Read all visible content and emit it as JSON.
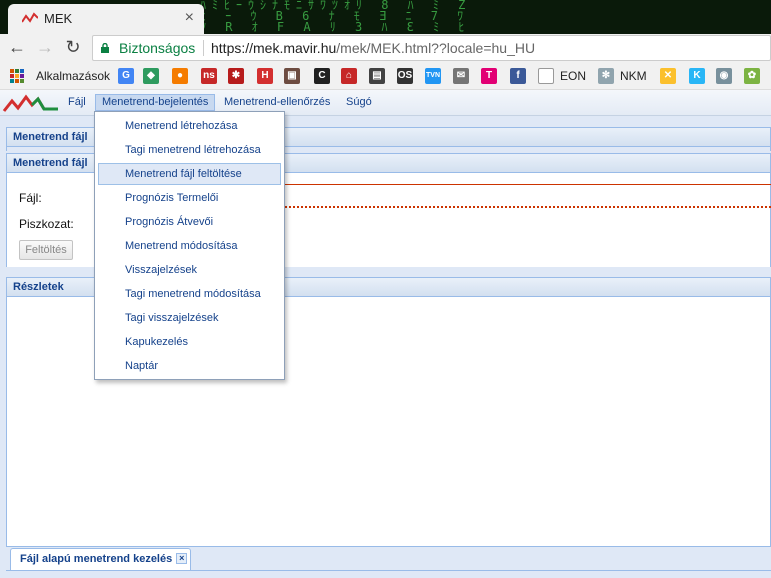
{
  "browser": {
    "tab_title": "MEK",
    "tab_close": "×",
    "secure_label": "Biztonságos",
    "url_host": "https://mek.mavir.hu",
    "url_path": "/mek/MEK.html??locale=hu_HU",
    "back": "←",
    "forward": "→",
    "reload": "↻",
    "matrix_text": "ﾊﾐﾋｰｳｼﾅﾓﾆｻﾜﾂｵﾘ 8 ﾊ ﾐ Z\nﾋ ｰ ｳ B 6 ﾅ ﾓ Ǝ ﾆ 7 ﾜ\nﾂ R ｵ F A ﾘ 3 ﾊ Ɛ ﾐ ﾋ"
  },
  "bookmarks": [
    {
      "label": "Alkalmazások",
      "icon": "apps-icon",
      "color": "#d35400"
    },
    {
      "label": "",
      "icon": "google-icon",
      "glyph": "G",
      "color": "#4285f4"
    },
    {
      "label": "",
      "icon": "diamond-icon",
      "glyph": "◆",
      "color": "#2e9b5f"
    },
    {
      "label": "",
      "icon": "circle-orange-icon",
      "glyph": "●",
      "color": "#f57c00"
    },
    {
      "label": "",
      "icon": "ns-icon",
      "glyph": "ns",
      "color": "#c62828"
    },
    {
      "label": "",
      "icon": "hu-icon",
      "glyph": "✱",
      "color": "#b71c1c"
    },
    {
      "label": "",
      "icon": "h-icon",
      "glyph": "H",
      "color": "#d32f2f"
    },
    {
      "label": "",
      "icon": "photo-icon",
      "glyph": "▣",
      "color": "#6d4c41"
    },
    {
      "label": "",
      "icon": "c-icon",
      "glyph": "C",
      "color": "#212121"
    },
    {
      "label": "",
      "icon": "house-icon",
      "glyph": "⌂",
      "color": "#c62828"
    },
    {
      "label": "",
      "icon": "film-icon",
      "glyph": "▤",
      "color": "#424242"
    },
    {
      "label": "",
      "icon": "os-icon",
      "glyph": "OS",
      "color": "#333333"
    },
    {
      "label": "",
      "icon": "tvn-icon",
      "glyph": "TVN",
      "color": "#2196f3"
    },
    {
      "label": "",
      "icon": "mail-icon",
      "glyph": "✉",
      "color": "#757575"
    },
    {
      "label": "",
      "icon": "telekom-icon",
      "glyph": "T",
      "color": "#e20074"
    },
    {
      "label": "",
      "icon": "facebook-icon",
      "glyph": "f",
      "color": "#3b5998"
    },
    {
      "label": "EON",
      "icon": "page-icon",
      "glyph": "",
      "color": "#9e9e9e"
    },
    {
      "label": "NKM",
      "icon": "snowflake-icon",
      "glyph": "✻",
      "color": "#90a4ae"
    },
    {
      "label": "",
      "icon": "raiffeisen-icon",
      "glyph": "✕",
      "color": "#fbc02d"
    },
    {
      "label": "",
      "icon": "k-icon",
      "glyph": "K",
      "color": "#29b6f6"
    },
    {
      "label": "",
      "icon": "owl-icon",
      "glyph": "◉",
      "color": "#78909c"
    },
    {
      "label": "",
      "icon": "frog-icon",
      "glyph": "✿",
      "color": "#7cb342"
    }
  ],
  "menu": {
    "items": [
      "Fájl",
      "Menetrend-bejelentés",
      "Menetrend-ellenőrzés",
      "Súgó"
    ],
    "dropdown": [
      "Menetrend létrehozása",
      "Tagi menetrend létrehozása",
      "Menetrend fájl feltöltése",
      "Prognózis Termelői",
      "Prognózis Átvevői",
      "Menetrend módosítása",
      "Visszajelzések",
      "Tagi menetrend módosítása",
      "Tagi visszajelzések",
      "Kapukezelés",
      "Naptár"
    ]
  },
  "panels": {
    "outer_title": "Menetrend fájl",
    "inner_title": "Menetrend fájl",
    "file_label": "Fájl:",
    "draft_label": "Piszkozat:",
    "upload_button": "Feltöltés",
    "details_title": "Részletek"
  },
  "bottom_tab": {
    "label": "Fájl alapú menetrend kezelés",
    "close": "×"
  }
}
